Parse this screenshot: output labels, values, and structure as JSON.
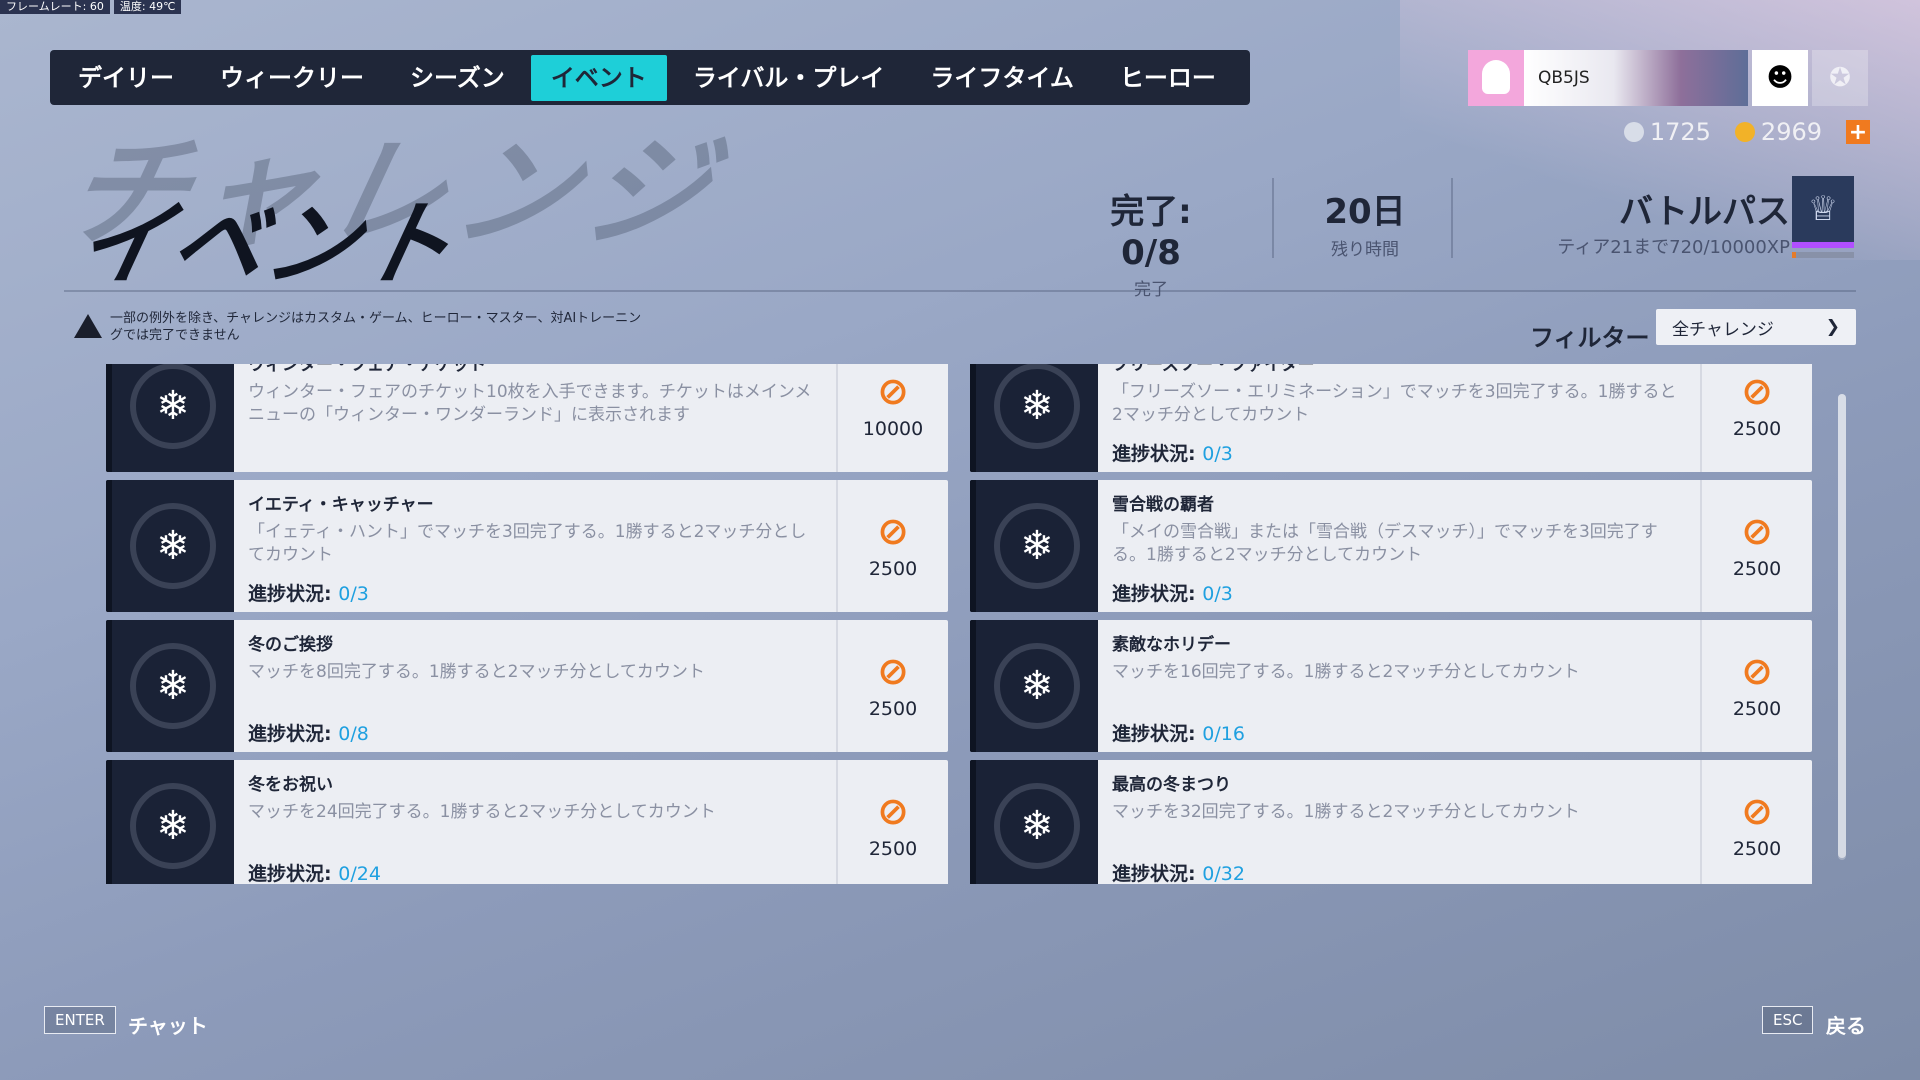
{
  "hud": {
    "framerate": "フレームレート: 60",
    "temp": "温度: 49℃"
  },
  "nav": {
    "tabs": [
      "デイリー",
      "ウィークリー",
      "シーズン",
      "イベント",
      "ライバル・プレイ",
      "ライフタイム",
      "ヒーロー"
    ],
    "active": "イベント"
  },
  "profile": {
    "name": "QB5JS"
  },
  "currency": {
    "credits": "1725",
    "coins": "2969",
    "plus": "+"
  },
  "title": {
    "bg": "チャレンジ",
    "main": "イベント"
  },
  "stats": {
    "complete_value": "完了: 0/8",
    "complete_label": "完了",
    "time_value": "20日",
    "time_label": "残り時間",
    "battlepass_title": "バトルパス",
    "battlepass_sub": "ティア21まで720/10000XP",
    "battlepass_progress": 0.072
  },
  "notice": "一部の例外を除き、チャレンジはカスタム・ゲーム、ヒーロー・マスター、対AIトレーニングでは完了できません",
  "filter": {
    "label": "フィルター",
    "value": "全チャレンジ"
  },
  "challenges": [
    {
      "title": "ウィンター・フェア・チケット",
      "desc": "ウィンター・フェアのチケット10枚を入手できます。チケットはメインメニューの「ウィンター・ワンダーランド」に表示されます",
      "progress_label": "",
      "progress": "",
      "reward": "10000"
    },
    {
      "title": "フリーズソー・ファイター",
      "desc": "「フリーズソー・エリミネーション」でマッチを3回完了する。1勝すると2マッチ分としてカウント",
      "progress_label": "進捗状況:",
      "progress": "0/3",
      "reward": "2500"
    },
    {
      "title": "イエティ・キャッチャー",
      "desc": "「イェティ・ハント」でマッチを3回完了する。1勝すると2マッチ分としてカウント",
      "progress_label": "進捗状況:",
      "progress": "0/3",
      "reward": "2500"
    },
    {
      "title": "雪合戦の覇者",
      "desc": "「メイの雪合戦」または「雪合戦（デスマッチ）」でマッチを3回完了する。1勝すると2マッチ分としてカウント",
      "progress_label": "進捗状況:",
      "progress": "0/3",
      "reward": "2500"
    },
    {
      "title": "冬のご挨拶",
      "desc": "マッチを8回完了する。1勝すると2マッチ分としてカウント",
      "progress_label": "進捗状況:",
      "progress": "0/8",
      "reward": "2500"
    },
    {
      "title": "素敵なホリデー",
      "desc": "マッチを16回完了する。1勝すると2マッチ分としてカウント",
      "progress_label": "進捗状況:",
      "progress": "0/16",
      "reward": "2500"
    },
    {
      "title": "冬をお祝い",
      "desc": "マッチを24回完了する。1勝すると2マッチ分としてカウント",
      "progress_label": "進捗状況:",
      "progress": "0/24",
      "reward": "2500"
    },
    {
      "title": "最高の冬まつり",
      "desc": "マッチを32回完了する。1勝すると2マッチ分としてカウント",
      "progress_label": "進捗状況:",
      "progress": "0/32",
      "reward": "2500"
    }
  ],
  "bottom": {
    "enter_key": "ENTER",
    "enter_label": "チャット",
    "esc_key": "ESC",
    "esc_label": "戻る"
  },
  "colors": {
    "accent": "#1ecfd8",
    "reward": "#f07a1f",
    "progress": "#1fa0e0"
  }
}
